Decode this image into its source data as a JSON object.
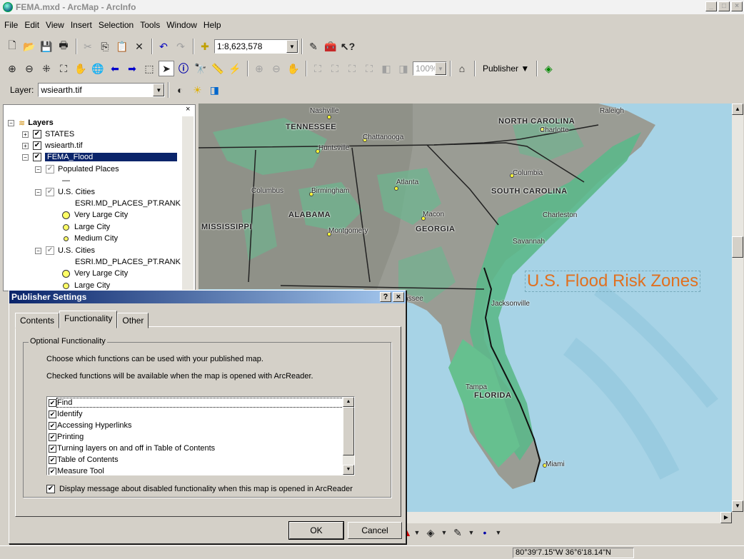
{
  "window": {
    "title": "FEMA.mxd - ArcMap - ArcInfo",
    "btn_min": "_",
    "btn_max": "□",
    "btn_close": "×"
  },
  "menu": [
    "File",
    "Edit",
    "View",
    "Insert",
    "Selection",
    "Tools",
    "Window",
    "Help"
  ],
  "toolbar": {
    "scale": "1:8,623,578",
    "zoom_pct": "100%",
    "publisher_label": "Publisher ▼",
    "layer_label": "Layer:",
    "layer_value": "wsiearth.tif"
  },
  "toc": {
    "root": "Layers",
    "items": [
      {
        "label": "STATES"
      },
      {
        "label": "wsiearth.tif"
      },
      {
        "label": "FEMA_Flood"
      },
      {
        "label": "Populated Places"
      },
      {
        "label": "—"
      },
      {
        "label": "U.S. Cities"
      },
      {
        "label": "ESRI.MD_PLACES_PT.RANK"
      },
      {
        "label": "Very Large City"
      },
      {
        "label": "Large City"
      },
      {
        "label": "Medium City"
      },
      {
        "label": "U.S. Cities"
      },
      {
        "label": "ESRI.MD_PLACES_PT.RANK"
      },
      {
        "label": "Very Large City"
      },
      {
        "label": "Large City"
      }
    ]
  },
  "map": {
    "title": "U.S. Flood Risk Zones",
    "states": [
      "TENNESSEE",
      "NORTH CAROLINA",
      "SOUTH CAROLINA",
      "ALABAMA",
      "GEORGIA",
      "MISSISSIPPI",
      "FLORIDA"
    ],
    "cities": [
      "Nashville",
      "Raleigh",
      "Charlotte",
      "Chattanooga",
      "Huntsville",
      "Columbia",
      "Atlanta",
      "Columbus",
      "Birmingham",
      "Macon",
      "Charleston",
      "Montgomery",
      "Savannah",
      "Tallahassee",
      "Jacksonville",
      "Tampa",
      "Miami"
    ]
  },
  "dialog": {
    "title": "Publisher Settings",
    "help": "?",
    "close": "×",
    "tabs": [
      "Contents",
      "Functionality",
      "Other"
    ],
    "group_label": "Optional Functionality",
    "text1": "Choose which functions can be used with your published map.",
    "text2": "Checked functions will be available when the map is opened with ArcReader.",
    "functions": [
      "Find",
      "Identify",
      "Accessing Hyperlinks",
      "Printing",
      "Turning layers on and off in Table of Contents",
      "Table of Contents",
      "Measure Tool"
    ],
    "display_msg": "Display message about disabled functionality when this map is opened in ArcReader",
    "ok": "OK",
    "cancel": "Cancel"
  },
  "status": {
    "coords": "80°39'7.15\"W  36°6'18.14\"N"
  }
}
